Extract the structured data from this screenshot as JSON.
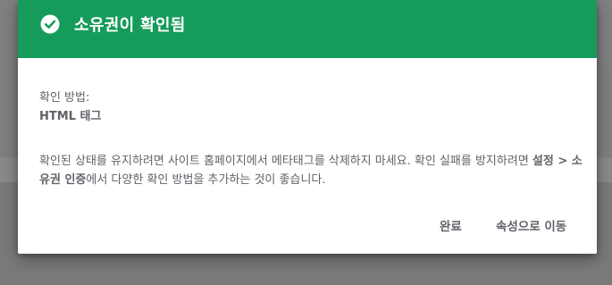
{
  "dialog": {
    "title": "소유권이 확인됨",
    "method_label": "확인 방법:",
    "method_value": "HTML 태그",
    "description_part1": "확인된 상태를 유지하려면 사이트 홈페이지에서 메타태그를 삭제하지 마세요. 확인 실패를 방지하려면 ",
    "description_bold": "설정 > 소유권 인증",
    "description_part2": "에서 다양한 확인 방법을 추가하는 것이 좋습니다.",
    "done_button": "완료",
    "go_to_property_button": "속성으로 이동",
    "icon": "check-circle-icon"
  },
  "colors": {
    "header_bg": "#159c5b",
    "overlay": "#7f7f7f",
    "text": "#5f6368"
  }
}
